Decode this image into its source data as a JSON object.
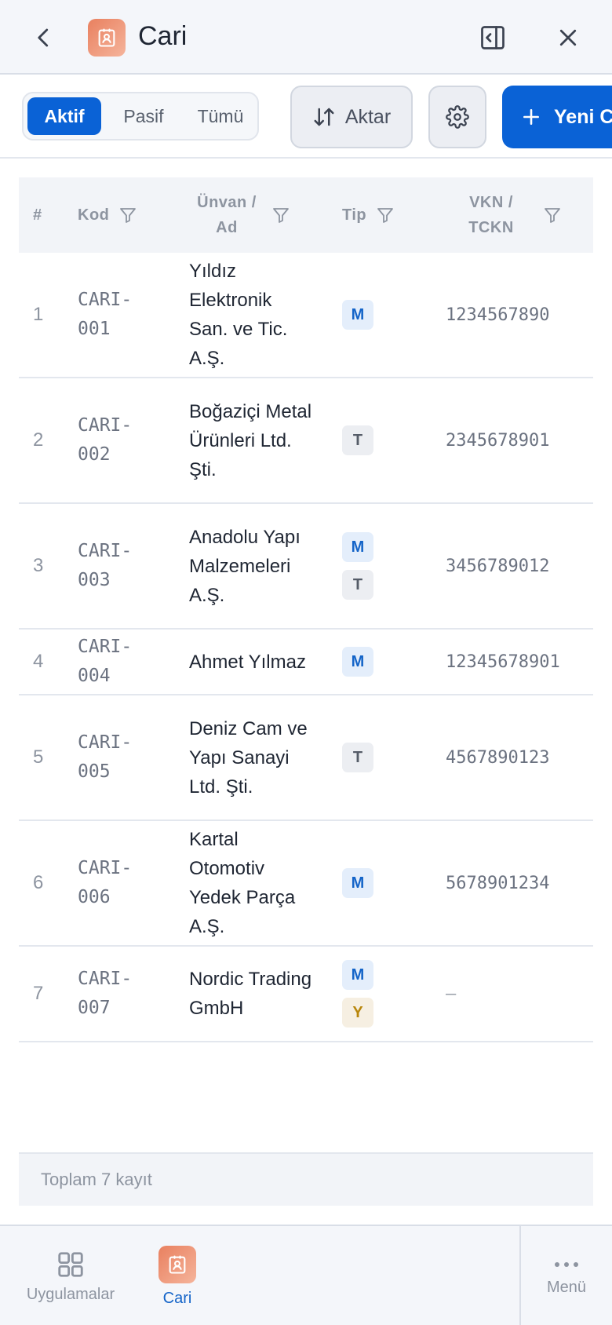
{
  "header": {
    "title": "Cari",
    "back_icon": "chevron-left-icon",
    "split_icon": "panel-collapse-icon",
    "close_icon": "close-icon",
    "logo_icon": "contact-card-icon"
  },
  "toolbar": {
    "segments": [
      {
        "label": "Aktif",
        "selected": true
      },
      {
        "label": "Pasif",
        "selected": false
      },
      {
        "label": "Tümü",
        "selected": false
      }
    ],
    "transfer_label": "Aktar",
    "new_label": "Yeni Cari"
  },
  "table": {
    "columns": {
      "num": "#",
      "kod": "Kod",
      "unvan": "Ünvan / Ad",
      "tip": "Tip",
      "vkn": "VKN / TCKN"
    },
    "rows": [
      {
        "num": "1",
        "kod": "CARI-001",
        "unvan": "Yıldız Elektronik San. ve Tic. A.Ş.",
        "tip": [
          "M"
        ],
        "vkn": "1234567890"
      },
      {
        "num": "2",
        "kod": "CARI-002",
        "unvan": "Boğaziçi Metal Ürünleri Ltd. Şti.",
        "tip": [
          "T"
        ],
        "vkn": "2345678901"
      },
      {
        "num": "3",
        "kod": "CARI-003",
        "unvan": "Anadolu Yapı Malzemeleri A.Ş.",
        "tip": [
          "M",
          "T"
        ],
        "vkn": "3456789012"
      },
      {
        "num": "4",
        "kod": "CARI-004",
        "unvan": "Ahmet Yılmaz",
        "tip": [
          "M"
        ],
        "vkn": "12345678901"
      },
      {
        "num": "5",
        "kod": "CARI-005",
        "unvan": "Deniz Cam ve Yapı Sanayi Ltd. Şti.",
        "tip": [
          "T"
        ],
        "vkn": "4567890123"
      },
      {
        "num": "6",
        "kod": "CARI-006",
        "unvan": "Kartal Otomotiv Yedek Parça A.Ş.",
        "tip": [
          "M"
        ],
        "vkn": "5678901234"
      },
      {
        "num": "7",
        "kod": "CARI-007",
        "unvan": "Nordic Trading GmbH",
        "tip": [
          "M",
          "Y"
        ],
        "vkn": "—"
      }
    ],
    "total_label": "Toplam 7 kayıt"
  },
  "bottomnav": {
    "apps_label": "Uygulamalar",
    "cari_label": "Cari",
    "menu_label": "Menü"
  },
  "colors": {
    "primary": "#0a62d6",
    "badge_m": "#1464c8",
    "badge_t": "#555c68",
    "badge_y": "#b8860b"
  }
}
